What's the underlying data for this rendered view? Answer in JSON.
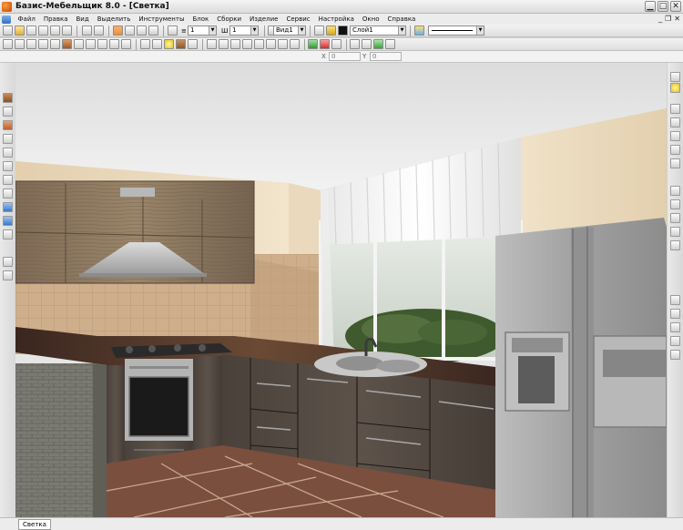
{
  "window": {
    "title": "Базис-Мебельщик 8.0 - [Светка]",
    "controls": {
      "minimize": "▁",
      "maximize": "□",
      "close": "✕"
    },
    "mdi_controls": {
      "minimize": "_",
      "restore": "❐",
      "close": "✕"
    }
  },
  "menu": {
    "items": [
      "Файл",
      "Правка",
      "Вид",
      "Выделить",
      "Инструменты",
      "Блок",
      "Сборки",
      "Изделие",
      "Сервис",
      "Настройка",
      "Окно",
      "Справка"
    ]
  },
  "toolbar1": {
    "combo_thickness": "1",
    "label_w": "Ш",
    "combo_width": "1",
    "combo_view": "Вид1",
    "combo_layer": "Слой1"
  },
  "coords": {
    "x_label": "X",
    "x_value": "0",
    "y_label": "Y",
    "y_value": "0"
  },
  "statusbar": {
    "tab": "Светка"
  },
  "colors": {
    "accent": "#e8903a",
    "chrome": "#d4d0c8",
    "wall": "#ead9bd",
    "cabinet": "#4f4640",
    "fridge": "#a6a6a6"
  }
}
